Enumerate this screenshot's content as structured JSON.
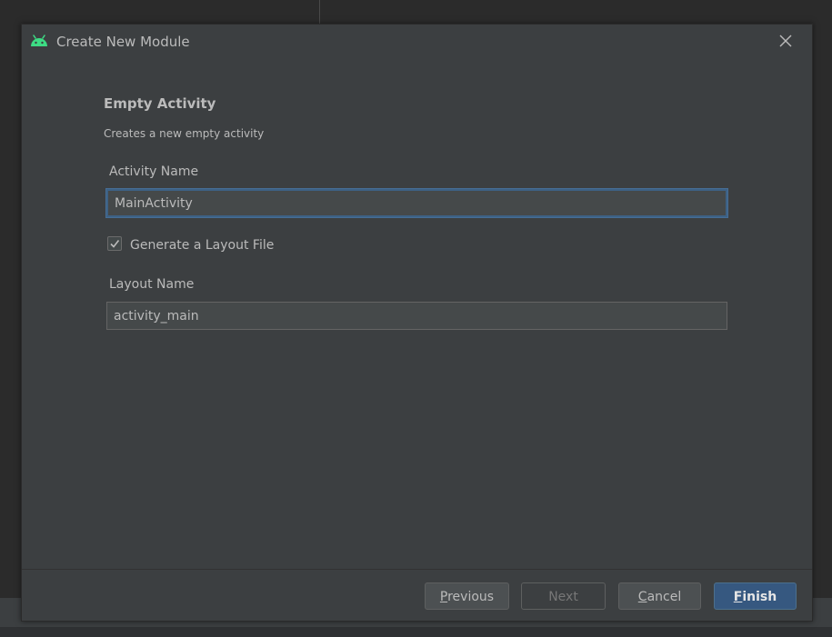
{
  "dialog": {
    "title": "Create New Module",
    "close_icon": "close-icon"
  },
  "template": {
    "heading": "Empty Activity",
    "description": "Creates a new empty activity"
  },
  "form": {
    "activity_name_label": "Activity Name",
    "activity_name_value": "MainActivity",
    "generate_layout_label": "Generate a Layout File",
    "generate_layout_checked": true,
    "layout_name_label": "Layout Name",
    "layout_name_value": "activity_main"
  },
  "buttons": {
    "previous_mnemonic": "P",
    "previous_rest": "revious",
    "next": "Next",
    "cancel_mnemonic": "C",
    "cancel_rest": "ancel",
    "finish_mnemonic": "F",
    "finish_rest": "inish"
  },
  "colors": {
    "android_green": "#3ddc84",
    "accent_blue": "#365880",
    "focus_border": "#3d6185"
  }
}
